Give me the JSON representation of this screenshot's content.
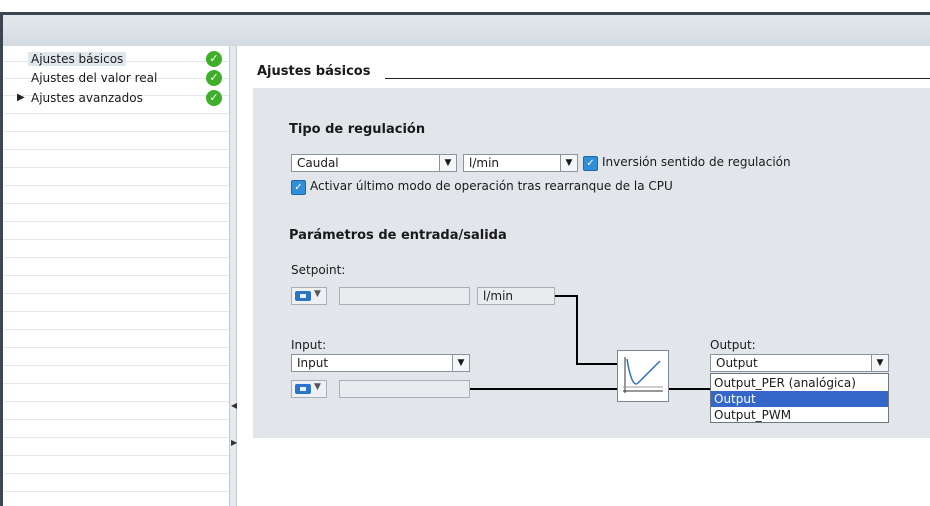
{
  "nav": {
    "items": [
      {
        "label": "Ajustes básicos",
        "selected": true,
        "expandable": false,
        "status": "ok"
      },
      {
        "label": "Ajustes del valor real",
        "selected": false,
        "expandable": false,
        "status": "ok"
      },
      {
        "label": "Ajustes avanzados",
        "selected": false,
        "expandable": true,
        "status": "ok"
      }
    ]
  },
  "main": {
    "section_title": "Ajustes básicos",
    "control_type": {
      "heading": "Tipo de regulación",
      "type_value": "Caudal",
      "unit_value": "l/min",
      "invert_label": "Inversión sentido de regulación",
      "invert_checked": true,
      "restart_label": "Activar último modo de operación tras rearranque de la CPU",
      "restart_checked": true
    },
    "io": {
      "heading": "Parámetros de entrada/salida",
      "setpoint_label": "Setpoint:",
      "setpoint_value": "",
      "setpoint_unit": "l/min",
      "input_label": "Input:",
      "input_select": "Input",
      "input_value": "",
      "output_label": "Output:",
      "output_select": "Output",
      "output_options": [
        "Output_PER (analógica)",
        "Output",
        "Output_PWM"
      ],
      "output_highlighted": "Output"
    }
  },
  "colors": {
    "check_ok": "#3fae2a",
    "selection": "#3467c8",
    "panel_bg": "#e2e6ea"
  }
}
